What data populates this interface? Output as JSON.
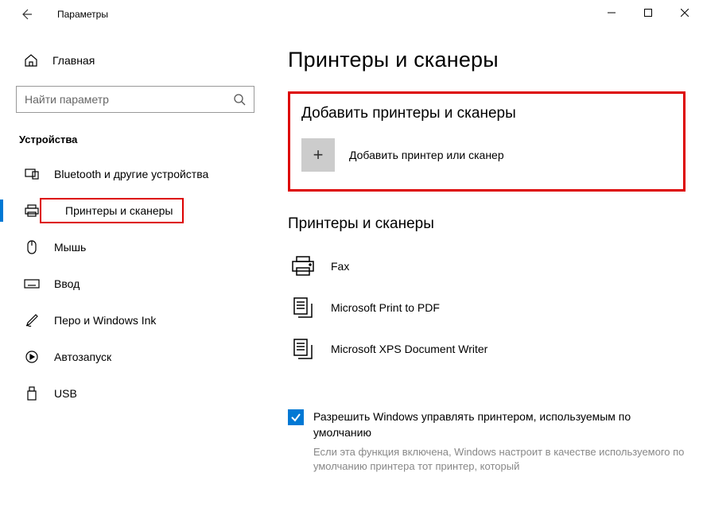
{
  "window": {
    "title": "Параметры"
  },
  "sidebar": {
    "home_label": "Главная",
    "search_placeholder": "Найти параметр",
    "section_title": "Устройства",
    "items": [
      {
        "label": "Bluetooth и другие устройства"
      },
      {
        "label": "Принтеры и сканеры"
      },
      {
        "label": "Мышь"
      },
      {
        "label": "Ввод"
      },
      {
        "label": "Перо и Windows Ink"
      },
      {
        "label": "Автозапуск"
      },
      {
        "label": "USB"
      }
    ]
  },
  "main": {
    "page_title": "Принтеры и сканеры",
    "add_section_title": "Добавить принтеры и сканеры",
    "add_button_label": "Добавить принтер или сканер",
    "list_section_title": "Принтеры и сканеры",
    "devices": [
      {
        "name": "Fax"
      },
      {
        "name": "Microsoft Print to PDF"
      },
      {
        "name": "Microsoft XPS Document Writer"
      }
    ],
    "checkbox_label": "Разрешить Windows управлять принтером, используемым по умолчанию",
    "checkbox_desc": "Если эта функция включена, Windows настроит в качестве используемого по умолчанию принтера тот принтер, который"
  }
}
